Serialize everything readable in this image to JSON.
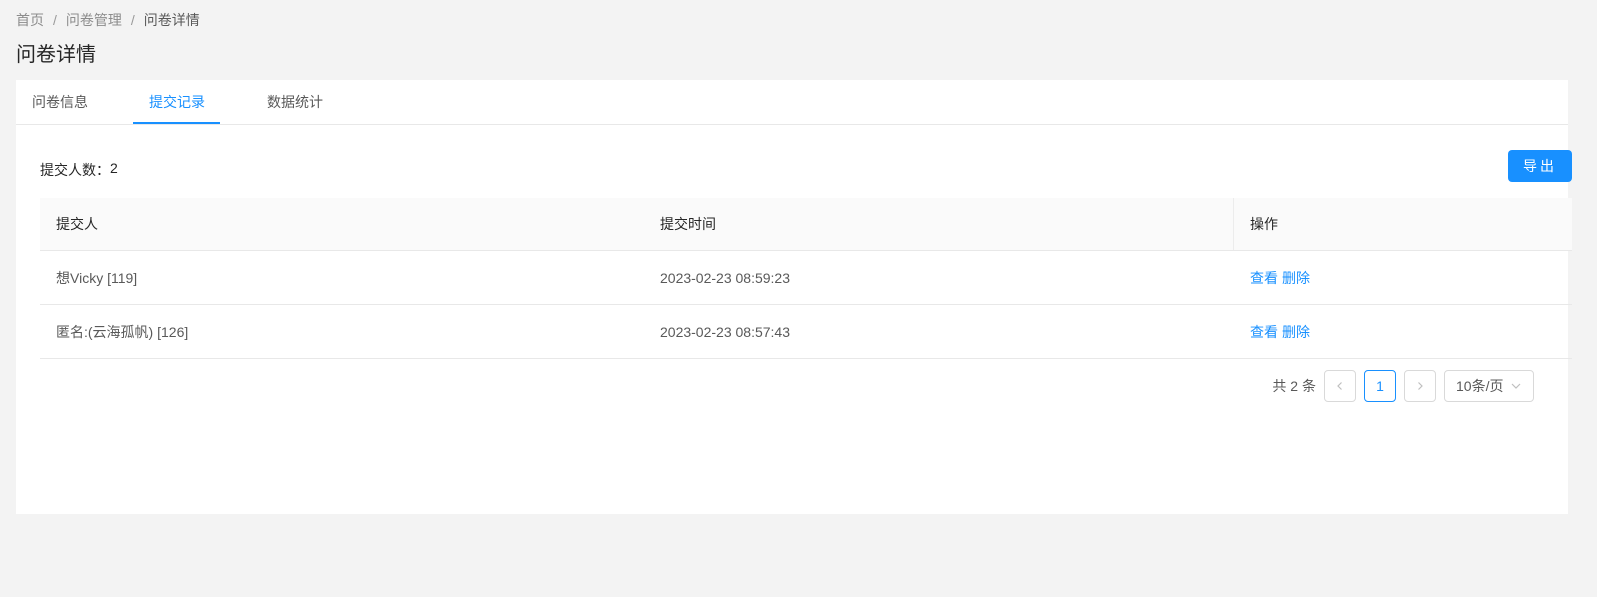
{
  "breadcrumb": {
    "items": [
      "首页",
      "问卷管理",
      "问卷详情"
    ],
    "separator": "/"
  },
  "page_title": "问卷详情",
  "tabs": [
    {
      "label": "问卷信息",
      "active": false
    },
    {
      "label": "提交记录",
      "active": true
    },
    {
      "label": "数据统计",
      "active": false
    }
  ],
  "summary": {
    "label": "提交人数：",
    "count": "2"
  },
  "toolbar": {
    "export_label": "导出"
  },
  "table": {
    "columns": [
      "提交人",
      "提交时间",
      "操作"
    ],
    "rows": [
      {
        "submitter": "想Vicky [119]",
        "time": "2023-02-23 08:59:23",
        "actions": [
          "查看",
          "删除"
        ]
      },
      {
        "submitter": "匿名:(云海孤帆) [126]",
        "time": "2023-02-23 08:57:43",
        "actions": [
          "查看",
          "删除"
        ]
      }
    ]
  },
  "pagination": {
    "total_text": "共 2 条",
    "current_page": "1",
    "page_size": "10条/页"
  },
  "colors": {
    "primary": "#1890ff",
    "background": "#f3f3f3",
    "header_bg": "#fafafa"
  }
}
